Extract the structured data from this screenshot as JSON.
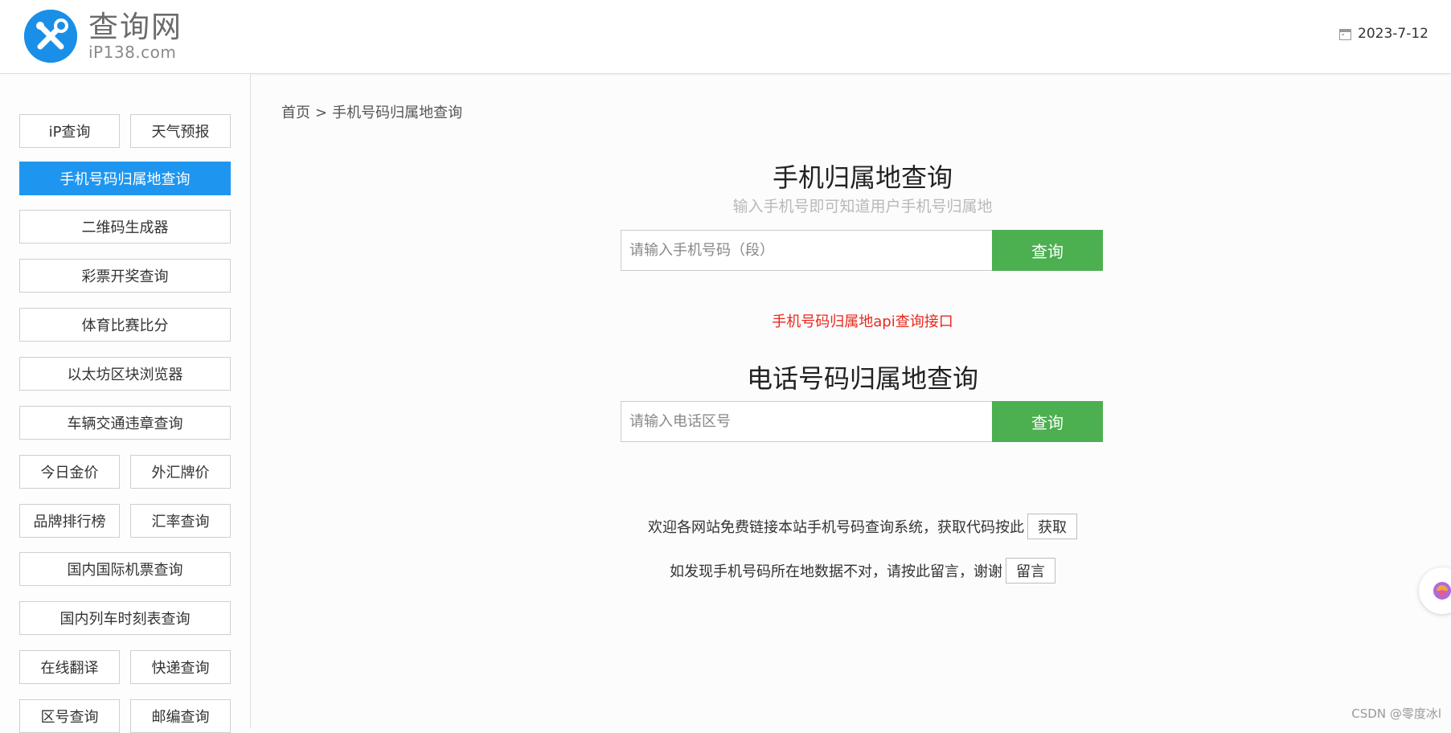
{
  "header": {
    "logo_title": "查询网",
    "logo_sub": "iP138.com",
    "date": "2023-7-12"
  },
  "sidebar": {
    "items": [
      {
        "label": "iP查询",
        "active": false
      },
      {
        "label": "天气预报",
        "active": false
      },
      {
        "label": "手机号码归属地查询",
        "active": true
      },
      {
        "label": "二维码生成器",
        "active": false
      },
      {
        "label": "彩票开奖查询",
        "active": false
      },
      {
        "label": "体育比赛比分",
        "active": false
      },
      {
        "label": "以太坊区块浏览器",
        "active": false
      },
      {
        "label": "车辆交通违章查询",
        "active": false
      },
      {
        "label": "今日金价",
        "active": false
      },
      {
        "label": "外汇牌价",
        "active": false
      },
      {
        "label": "品牌排行榜",
        "active": false
      },
      {
        "label": "汇率查询",
        "active": false
      },
      {
        "label": "国内国际机票查询",
        "active": false
      },
      {
        "label": "国内列车时刻表查询",
        "active": false
      },
      {
        "label": "在线翻译",
        "active": false
      },
      {
        "label": "快递查询",
        "active": false
      },
      {
        "label": "区号查询",
        "active": false
      },
      {
        "label": "邮编查询",
        "active": false
      }
    ]
  },
  "breadcrumb": {
    "home": "首页",
    "separator": ">",
    "current": "手机号码归属地查询"
  },
  "mobile_section": {
    "title": "手机归属地查询",
    "subtitle": "输入手机号即可知道用户手机号归属地",
    "placeholder": "请输入手机号码（段）",
    "button": "查询"
  },
  "api_link": "手机号码归属地api查询接口",
  "phone_section": {
    "title": "电话号码归属地查询",
    "placeholder": "请输入电话区号",
    "button": "查询"
  },
  "info": {
    "link_text": "欢迎各网站免费链接本站手机号码查询系统，获取代码按此",
    "link_button": "获取",
    "feedback_text": "如发现手机号码所在地数据不对，请按此留言，谢谢",
    "feedback_button": "留言"
  },
  "watermark": "CSDN @零度冰l",
  "colors": {
    "accent_blue": "#1e96f0",
    "search_green": "#4caf50",
    "link_red": "#e8281e"
  }
}
